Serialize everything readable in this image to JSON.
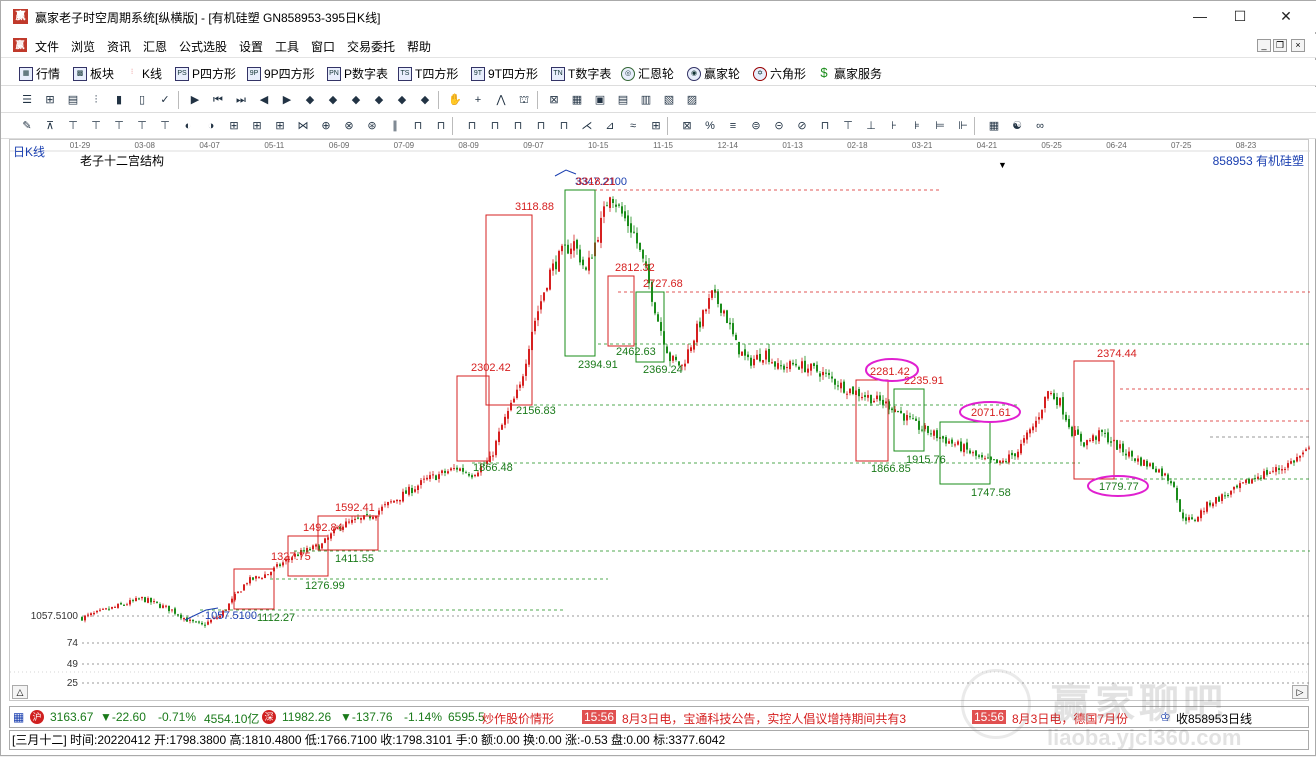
{
  "window": {
    "title": "赢家老子时空周期系统[纵横版] - [有机硅塑  GN858953-395日K线]",
    "app_icon": "赢"
  },
  "menu": [
    "文件",
    "浏览",
    "资讯",
    "汇恩",
    "公式选股",
    "设置",
    "工具",
    "窗口",
    "交易委托",
    "帮助"
  ],
  "toolbar1": [
    {
      "icon": "quote-icon",
      "label": "行情"
    },
    {
      "icon": "sector-icon",
      "label": "板块"
    },
    {
      "icon": "kline-icon",
      "label": "K线"
    },
    {
      "icon": "p-square-icon",
      "label": "P四方形"
    },
    {
      "icon": "9p-square-icon",
      "label": "9P四方形"
    },
    {
      "icon": "p-number-table-icon",
      "label": "P数字表"
    },
    {
      "icon": "t-square-icon",
      "label": "T四方形"
    },
    {
      "icon": "9t-square-icon",
      "label": "9T四方形"
    },
    {
      "icon": "t-number-table-icon",
      "label": "T数字表"
    },
    {
      "icon": "huien-wheel-icon",
      "label": "汇恩轮"
    },
    {
      "icon": "winner-wheel-icon",
      "label": "赢家轮"
    },
    {
      "icon": "hexagon-icon",
      "label": "六角形"
    },
    {
      "icon": "dollar-icon",
      "label": "赢家服务"
    }
  ],
  "chart": {
    "period_label": "日K线",
    "study_title": "老子十二宫结构",
    "instrument": "858953 有机硅塑",
    "date_axis": [
      "01-29",
      "03-08",
      "04-07",
      "05-11",
      "06-09",
      "07-09",
      "08-09",
      "09-07",
      "10-15",
      "11-15",
      "12-14",
      "01-13",
      "02-18",
      "03-21",
      "04-21",
      "05-25",
      "06-24",
      "07-25",
      "08-23"
    ],
    "left_axis": [
      "1057.5100",
      "74",
      "49",
      "25"
    ],
    "price_labels": [
      {
        "text": "3347.2100",
        "color": "#1a3fb0"
      },
      {
        "text": "3318.21",
        "color": "#d62020"
      },
      {
        "text": "3118.88",
        "color": "#d62020"
      },
      {
        "text": "2812.32",
        "color": "#d62020"
      },
      {
        "text": "2727.68",
        "color": "#d62020"
      },
      {
        "text": "2462.63",
        "color": "#1a7a1a"
      },
      {
        "text": "2394.91",
        "color": "#1a7a1a"
      },
      {
        "text": "2369.24",
        "color": "#1a7a1a"
      },
      {
        "text": "2302.42",
        "color": "#d62020"
      },
      {
        "text": "2156.83",
        "color": "#1a7a1a"
      },
      {
        "text": "1866.48",
        "color": "#1a7a1a"
      },
      {
        "text": "1592.41",
        "color": "#d62020"
      },
      {
        "text": "1492.84",
        "color": "#d62020"
      },
      {
        "text": "1411.55",
        "color": "#1a7a1a"
      },
      {
        "text": "1327.75",
        "color": "#d62020"
      },
      {
        "text": "1276.99",
        "color": "#1a7a1a"
      },
      {
        "text": "1112.27",
        "color": "#1a7a1a"
      },
      {
        "text": "1057.5100",
        "color": "#1a3fb0"
      },
      {
        "text": "2281.42",
        "color": "#d62020"
      },
      {
        "text": "2235.91",
        "color": "#d62020"
      },
      {
        "text": "1866.85",
        "color": "#1a7a1a"
      },
      {
        "text": "1915.76",
        "color": "#1a7a1a"
      },
      {
        "text": "2071.61",
        "color": "#d62020"
      },
      {
        "text": "1747.58",
        "color": "#1a7a1a"
      },
      {
        "text": "2374.44",
        "color": "#d62020"
      },
      {
        "text": "1779.77",
        "color": "#1a7a1a"
      }
    ],
    "colors": {
      "up": "#d62020",
      "down": "#1a8c1a",
      "box_red": "#d62020",
      "box_green": "#1a8c1a",
      "circle": "#e020d0"
    }
  },
  "status1": {
    "idx1_value": "3163.67",
    "idx1_change": "▼-22.60",
    "idx1_pct": "-0.71%",
    "idx1_amount": "4554.10亿",
    "idx2_value": "11982.26",
    "idx2_change": "▼-137.76",
    "idx2_pct": "-1.14%",
    "idx2_amount": "6595.5",
    "ticker_label": "炒作股价情形",
    "news1_time": "15:56",
    "news1_text": "8月3日电，宝通科技公告，实控人倡议增持期间共有3",
    "news2_time": "15:56",
    "news2_text": "8月3日电，德国7月份",
    "alert_text": "收858953日线"
  },
  "status2": {
    "text": "[三月十二] 时间:20220412 开:1798.3800 高:1810.4800 低:1766.7100 收:1798.3101 手:0 额:0.00 换:0.00 涨:-0.53 盘:0.00 标:3377.6042"
  },
  "watermark": {
    "text": "赢家聊吧",
    "url": "liaoba.yjcl360.com"
  }
}
